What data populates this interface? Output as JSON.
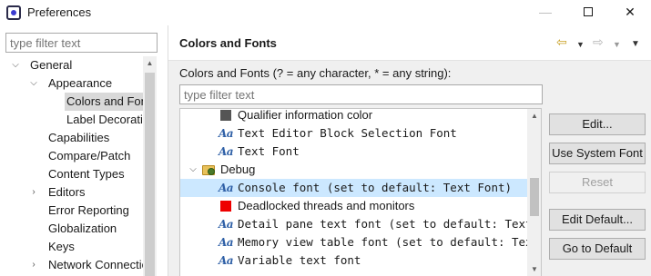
{
  "window": {
    "title": "Preferences",
    "minimize_glyph": "—",
    "close_glyph": "✕"
  },
  "left": {
    "filter_placeholder": "type filter text",
    "tree": [
      {
        "label": "General",
        "level": 0,
        "state": "expanded"
      },
      {
        "label": "Appearance",
        "level": 1,
        "state": "expanded"
      },
      {
        "label": "Colors and Fonts",
        "level": 2,
        "state": "leaf",
        "selected": true
      },
      {
        "label": "Label Decorations",
        "level": 2,
        "state": "leaf"
      },
      {
        "label": "Capabilities",
        "level": 1,
        "state": "leaf"
      },
      {
        "label": "Compare/Patch",
        "level": 1,
        "state": "leaf"
      },
      {
        "label": "Content Types",
        "level": 1,
        "state": "leaf"
      },
      {
        "label": "Editors",
        "level": 1,
        "state": "collapsed"
      },
      {
        "label": "Error Reporting",
        "level": 1,
        "state": "leaf"
      },
      {
        "label": "Globalization",
        "level": 1,
        "state": "leaf"
      },
      {
        "label": "Keys",
        "level": 1,
        "state": "leaf"
      },
      {
        "label": "Network Connections",
        "level": 1,
        "state": "collapsed"
      }
    ]
  },
  "header": {
    "title": "Colors and Fonts",
    "back_icon": "back-arrow-icon",
    "forward_icon": "forward-arrow-icon",
    "menu_icon": "view-menu-icon"
  },
  "content": {
    "description": "Colors and Fonts (? = any character, * = any string):",
    "filter_placeholder": "type filter text",
    "rows": [
      {
        "kind": "color",
        "label": "Qualifier information color",
        "swatch": "#555555"
      },
      {
        "kind": "font",
        "label": "Text Editor Block Selection Font"
      },
      {
        "kind": "font",
        "label": "Text Font"
      },
      {
        "kind": "category",
        "label": "Debug",
        "state": "expanded"
      },
      {
        "kind": "font",
        "label": "Console font (set to default: Text Font)",
        "selected": true
      },
      {
        "kind": "color",
        "label": "Deadlocked threads and monitors",
        "swatch": "#ee0000"
      },
      {
        "kind": "font",
        "label": "Detail pane text font (set to default: Text Font)"
      },
      {
        "kind": "font",
        "label": "Memory view table font (set to default: Text Font)"
      },
      {
        "kind": "font",
        "label": "Variable text font"
      }
    ],
    "font_glyph": "Aa",
    "scroll_up": "▲",
    "scroll_down": "▼"
  },
  "buttons": {
    "edit": "Edit...",
    "use_system_font": "Use System Font",
    "reset": "Reset",
    "edit_default": "Edit Default...",
    "go_to_default": "Go to Default"
  },
  "colors": {
    "selection_bg": "#cce8ff",
    "tree_selection_bg": "#d9d9d9",
    "font_icon": "#2e5fa6",
    "back_nav": "#c9a227"
  }
}
